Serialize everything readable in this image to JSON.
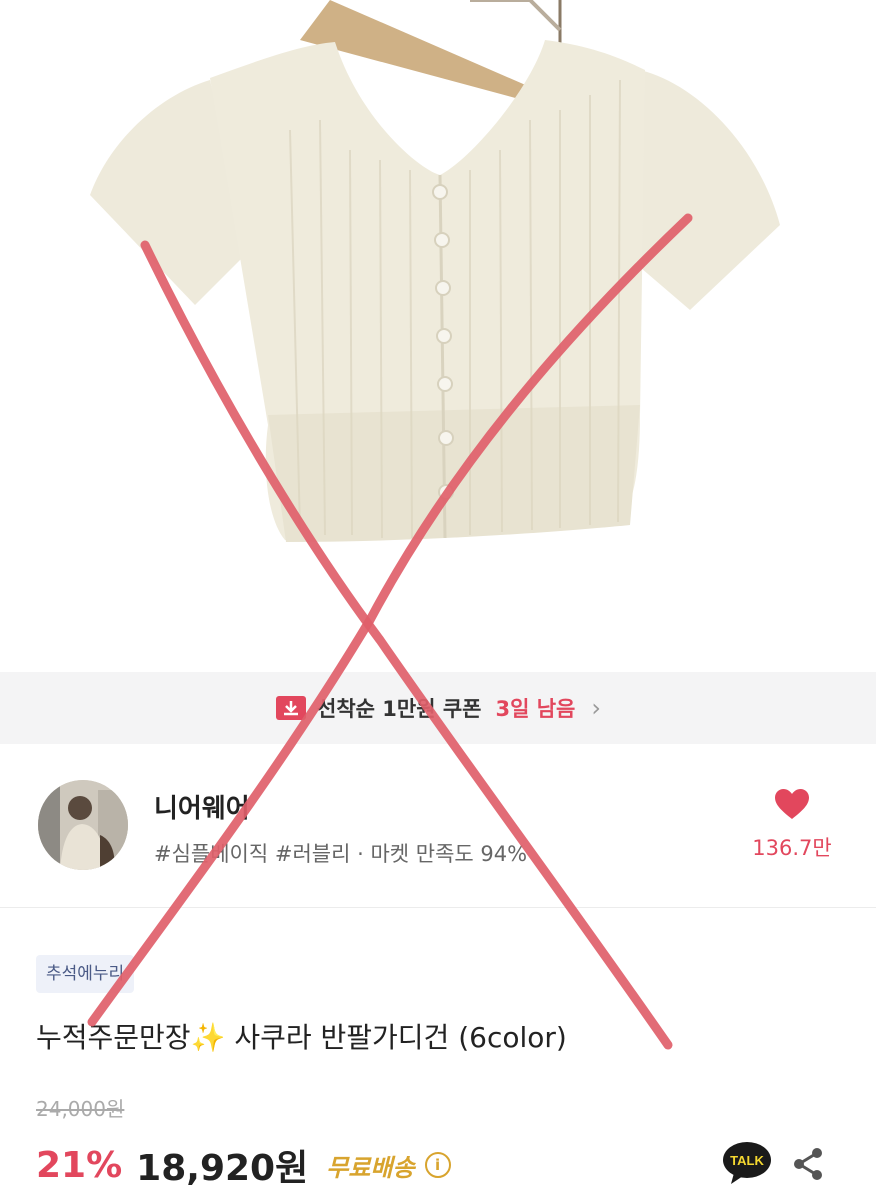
{
  "coupon": {
    "text": "선착순 1만원 쿠폰",
    "remaining": "3일 남음"
  },
  "shop": {
    "name": "니어웨어",
    "tags": "#심플베이직 #러블리 · 마켓 만족도 94%",
    "favorite_count": "136.7만"
  },
  "product": {
    "badge": "추석에누리",
    "title": "누적주문만장✨ 사쿠라 반팔가디건 (6color)",
    "original_price": "24,000원",
    "discount": "21%",
    "price": "18,920원",
    "shipping": "무료배송"
  },
  "actions": {
    "talk_label": "TALK"
  },
  "colors": {
    "accent": "#e2475d",
    "shipping": "#d8a42e",
    "cross": "#e0606a",
    "knit": "#efebdc"
  },
  "icons": [
    "coupon-download-icon",
    "chevron-right-icon",
    "heart-icon",
    "info-icon",
    "kakao-talk-icon",
    "share-icon"
  ]
}
